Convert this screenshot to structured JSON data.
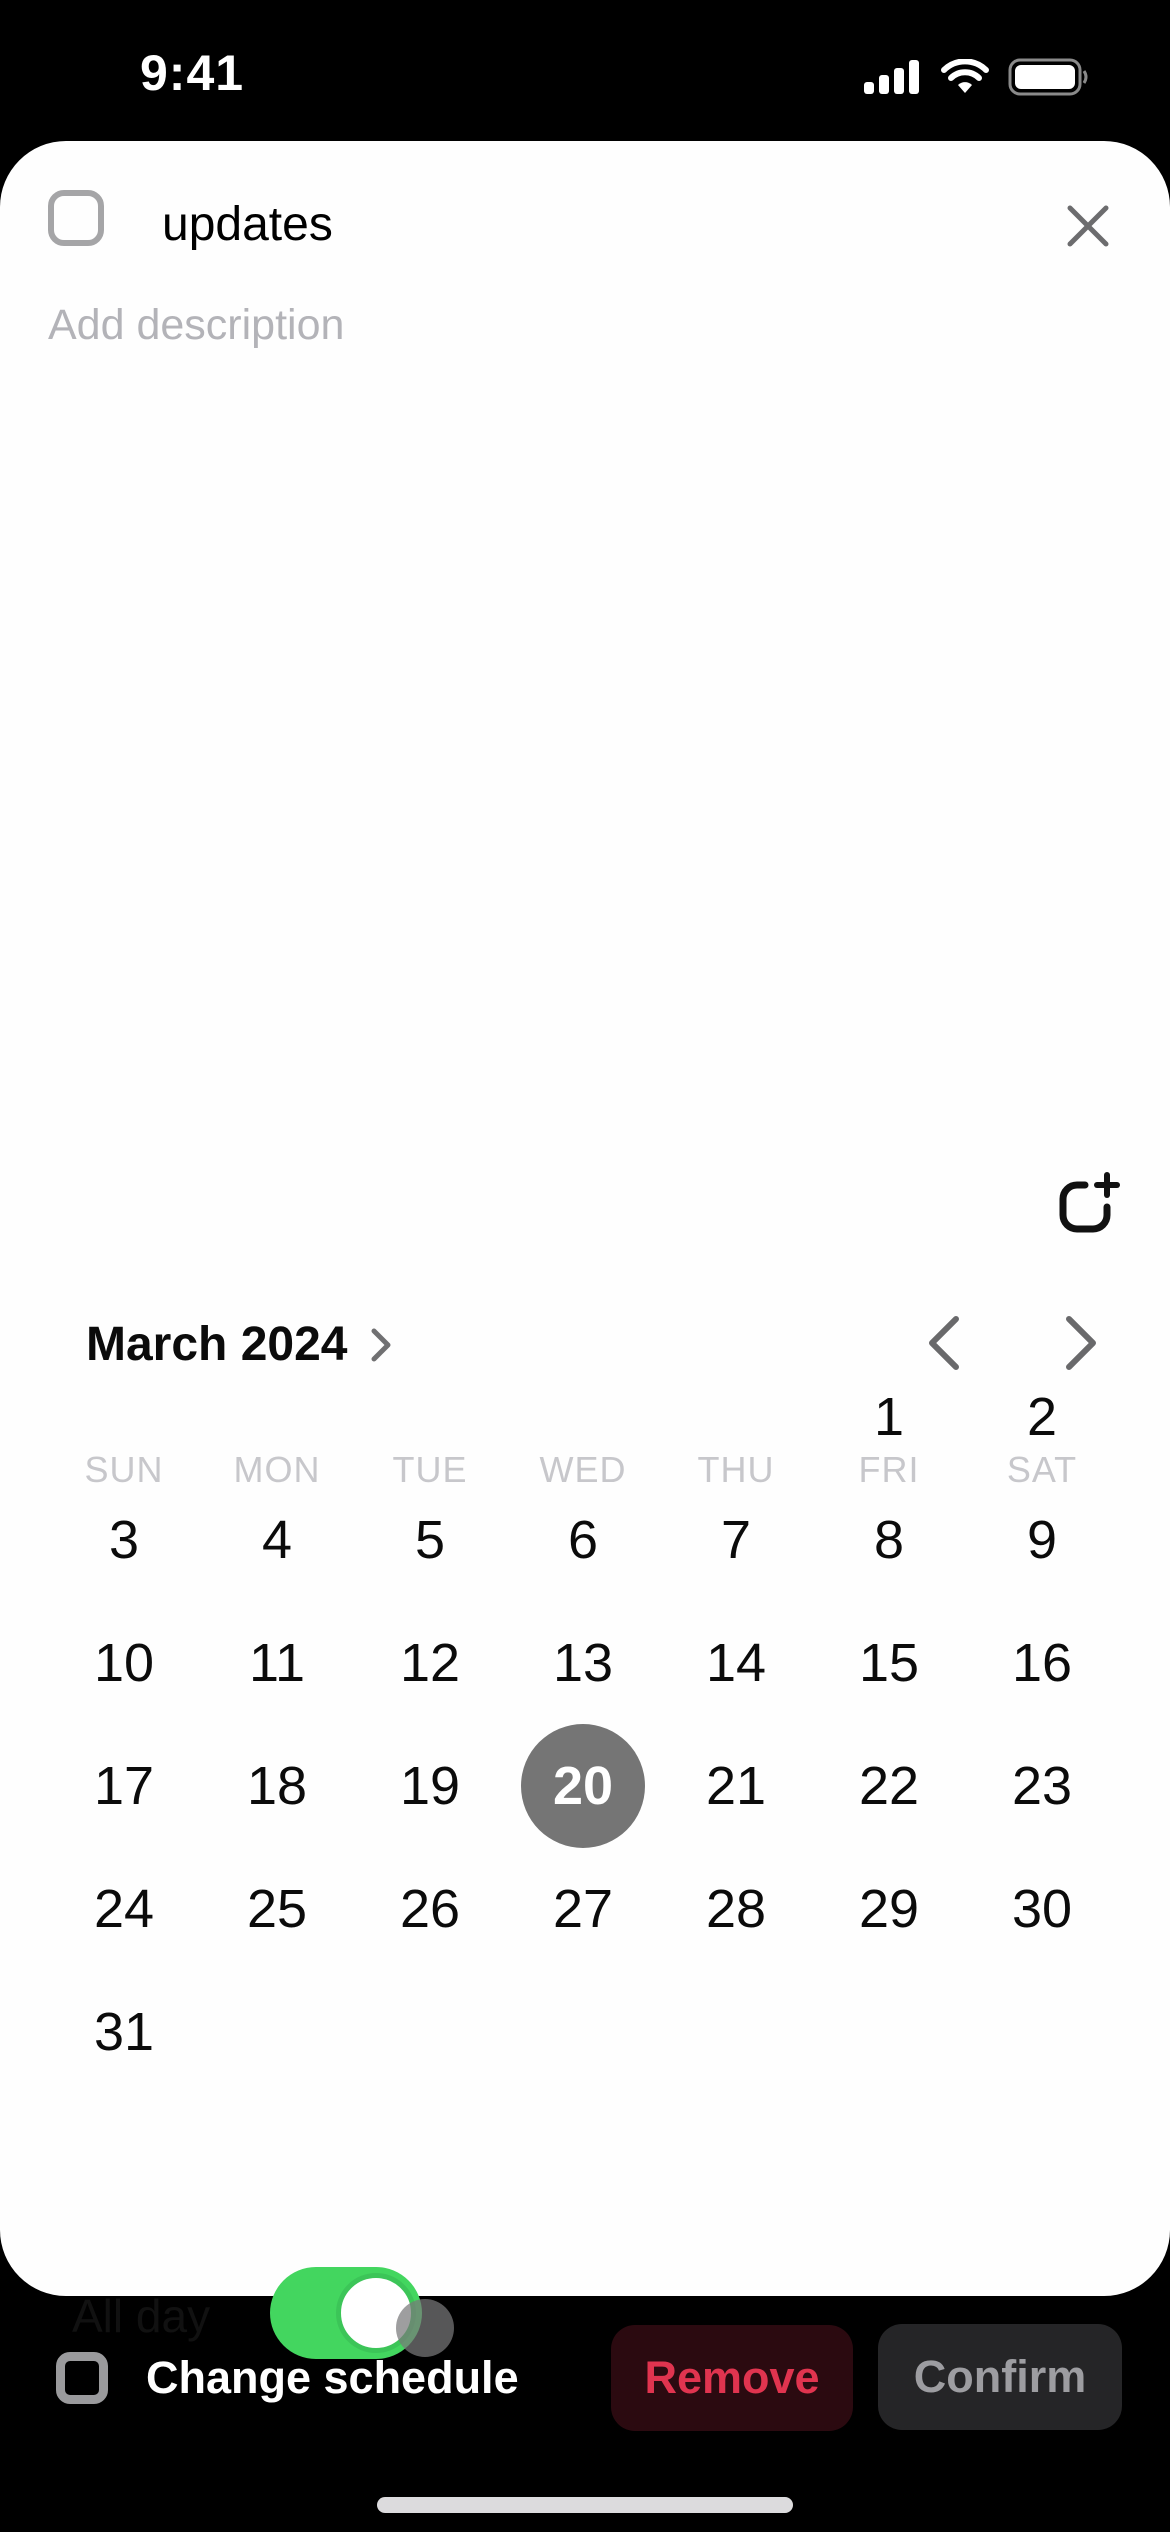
{
  "status_bar": {
    "time": "9:41",
    "icons": [
      "cellular-signal-icon",
      "wifi-icon",
      "battery-icon"
    ]
  },
  "task": {
    "title": "updates",
    "completed": false,
    "description_placeholder": "Add description",
    "close_icon": "close-icon",
    "add_subtask_icon": "add-subtask-icon"
  },
  "calendar": {
    "month_label": "March 2024",
    "month_chevron_icon": "chevron-right-icon",
    "prev_icon": "chevron-left-icon",
    "next_icon": "chevron-right-icon",
    "weekdays": [
      "SUN",
      "MON",
      "TUE",
      "WED",
      "THU",
      "FRI",
      "SAT"
    ],
    "first_weekday_index": 5,
    "days_in_month": 31,
    "selected_day": 20,
    "selected_color": "#757575"
  },
  "all_day": {
    "label": "All day",
    "enabled": true,
    "on_color": "#43d65f"
  },
  "footer": {
    "change_schedule_label": "Change schedule",
    "change_schedule_checked": false,
    "remove_label": "Remove",
    "confirm_label": "Confirm",
    "remove_color": "#e0344f"
  }
}
